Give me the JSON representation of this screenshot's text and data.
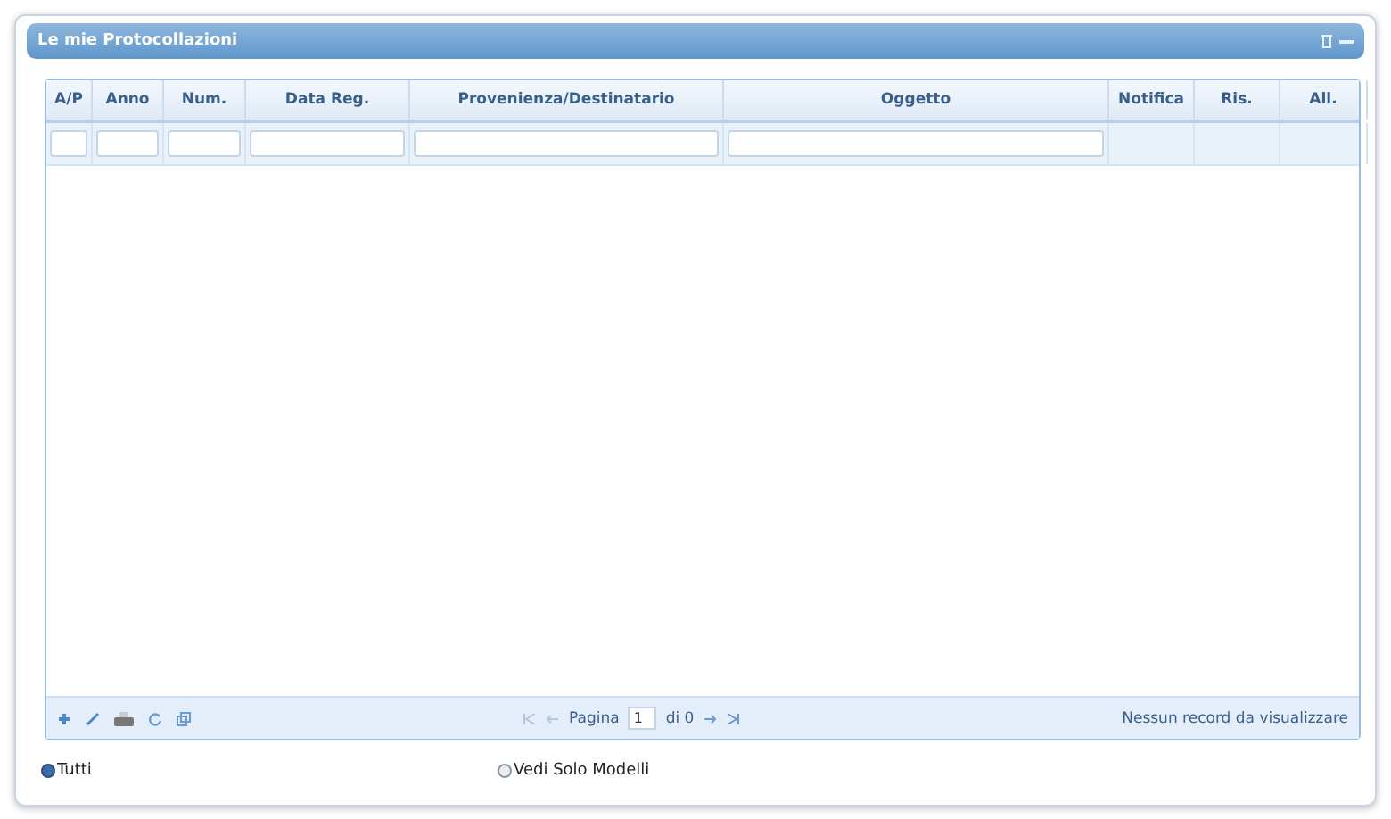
{
  "panel": {
    "title": "Le mie Protocollazioni"
  },
  "table": {
    "columns": [
      {
        "label": "A/P",
        "filter": true
      },
      {
        "label": "Anno",
        "filter": true
      },
      {
        "label": "Num.",
        "filter": true
      },
      {
        "label": "Data Reg.",
        "filter": true
      },
      {
        "label": "Provenienza/Destinatario",
        "filter": true
      },
      {
        "label": "Oggetto",
        "filter": true
      },
      {
        "label": "Notifica",
        "filter": false
      },
      {
        "label": "Ris.",
        "filter": false
      },
      {
        "label": "All.",
        "filter": false
      }
    ]
  },
  "pager": {
    "page_label": "Pagina",
    "page_value": "1",
    "of_label": "di 0",
    "status": "Nessun record da visualizzare"
  },
  "filters": [
    {
      "label": "Tutti",
      "selected": true
    },
    {
      "label": "Vedi Solo Modelli",
      "selected": false
    }
  ]
}
